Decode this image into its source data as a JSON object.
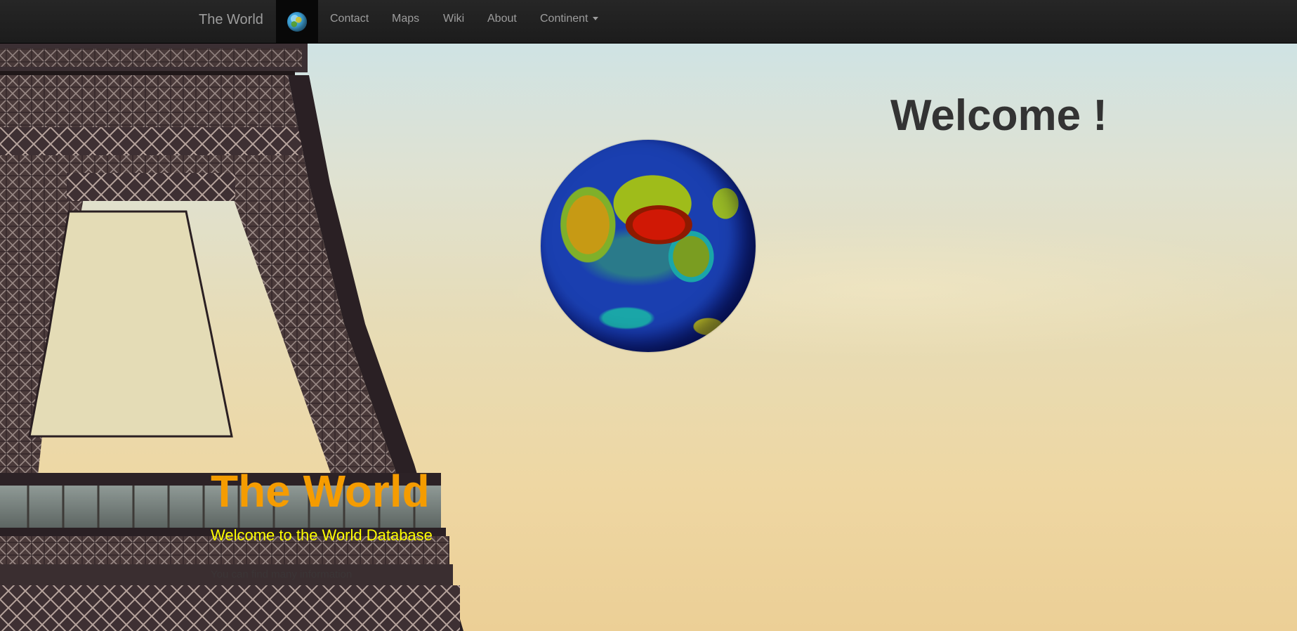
{
  "navbar": {
    "brand": "The World",
    "globe_icon": "globe-icon",
    "items": [
      {
        "label": "Contact"
      },
      {
        "label": "Maps"
      },
      {
        "label": "Wiki"
      },
      {
        "label": "About"
      },
      {
        "label": "Continent",
        "has_dropdown": true
      }
    ]
  },
  "hero": {
    "welcome": "Welcome !",
    "title": "The World",
    "subtitle": "Welcome to the World Database",
    "note": "You can find many information",
    "image": "eiffel-tower-photo",
    "globe_image": "rotating-earth-globe"
  },
  "colors": {
    "navbar_bg": "#222222",
    "nav_text": "#9d9d9d",
    "title": "#f59c00",
    "subtitle": "#ffff00",
    "welcome": "#333333"
  }
}
